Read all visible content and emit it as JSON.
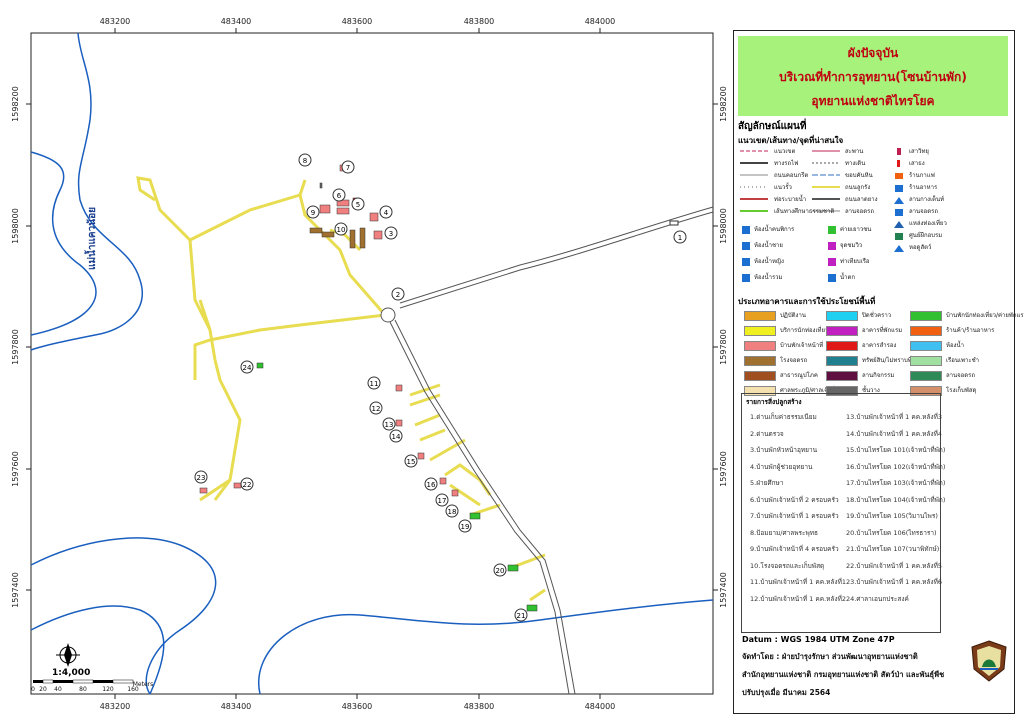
{
  "title": {
    "line1": "ผังปัจจุบัน",
    "line2": "บริเวณที่ทำการอุทยาน(โซนบ้านพัก)",
    "line3": "อุทยานแห่งชาติไทรโยค"
  },
  "legend": {
    "heading": "สัญลักษณ์แผนที่",
    "lines_heading": "แนวเขต/เส้นทาง/จุดที่น่าสนใจ",
    "lines": [
      {
        "label": "แนวเขต",
        "color": "#c02050"
      },
      {
        "label": "ทางรถไฟ",
        "color": "#444444"
      },
      {
        "label": "ถนนคอนกรีต",
        "color": "#888888"
      },
      {
        "label": "แนวรั้ว",
        "color": "#666666"
      },
      {
        "label": "ท่อระบายน้ำ",
        "color": "#c04040"
      },
      {
        "label": "เส้นทางศึกษาธรรมชาติ",
        "color": "#66cc33"
      },
      {
        "label": "สะพาน",
        "color": "#c02050"
      },
      {
        "label": "ทางเดิน",
        "color": "#555555"
      },
      {
        "label": "ขอบคันหิน",
        "color": "#3070c0"
      },
      {
        "label": "ถนนลูกรัง",
        "color": "#e8dc50"
      },
      {
        "label": "ถนนลาดยาง",
        "color": "#555555"
      },
      {
        "label": "ลานจอดรถ",
        "color": "#888888"
      }
    ],
    "points": [
      {
        "label": "เสาวิทยุ",
        "icon": "radio-tower-icon"
      },
      {
        "label": "เสาธง",
        "icon": "flag-icon"
      },
      {
        "label": "ร้านกาแฟ",
        "icon": "coffee-icon"
      },
      {
        "label": "ร้านอาหาร",
        "icon": "restaurant-icon"
      },
      {
        "label": "ลานกางเต็นท์",
        "icon": "tent-icon"
      },
      {
        "label": "ลานจอดรถ",
        "icon": "parking-icon"
      },
      {
        "label": "แหล่งท่องเที่ยว",
        "icon": "attraction-icon"
      },
      {
        "label": "ศูนย์ฝึกอบรม",
        "icon": "training-icon"
      },
      {
        "label": "หอดูสัตว์",
        "icon": "watchtower-icon"
      },
      {
        "label": "ห้องน้ำคนพิการ",
        "icon": "accessible-toilet-icon"
      },
      {
        "label": "ห้องน้ำชาย",
        "icon": "men-toilet-icon"
      },
      {
        "label": "ห้องน้ำหญิง",
        "icon": "women-toilet-icon"
      },
      {
        "label": "ห้องน้ำรวม",
        "icon": "restroom-icon"
      },
      {
        "label": "ค่ายเยาวชน",
        "icon": "youth-camp-icon"
      },
      {
        "label": "จุดชมวิว",
        "icon": "viewpoint-icon"
      },
      {
        "label": "ท่าเทียบเรือ",
        "icon": "pier-icon"
      },
      {
        "label": "น้ำตก",
        "icon": "waterfall-icon"
      }
    ],
    "building_heading": "ประเภทอาคารและการใช้ประโยชน์พื้นที่",
    "buildings": [
      {
        "label": "ปฏิบัติงาน",
        "color": "#e8a020"
      },
      {
        "label": "บริการนักท่องเที่ยว",
        "color": "#f0f020"
      },
      {
        "label": "บ้านพักเจ้าหน้าที่",
        "color": "#f08080"
      },
      {
        "label": "โรงจอดรถ",
        "color": "#a07030"
      },
      {
        "label": "สาธารณูปโภค",
        "color": "#a05020"
      },
      {
        "label": "ศาลพระภูมิ/ศาลเจ้าที่",
        "color": "#f5e0b0"
      },
      {
        "label": "ปิดชั่วคราว",
        "color": "#20d0f0"
      },
      {
        "label": "อาคารที่พักแรม",
        "color": "#c020c0"
      },
      {
        "label": "อาคารสำรอง",
        "color": "#e01818"
      },
      {
        "label": "ทรัพย์สิน/ไม่ทราบที่มา",
        "color": "#208090"
      },
      {
        "label": "ลานกิจกรรม",
        "color": "#601040"
      },
      {
        "label": "ชั้นวาง",
        "color": "#666666"
      },
      {
        "label": "บ้านพักนักท่องเที่ยว/ค่ายพักแรม",
        "color": "#30c030"
      },
      {
        "label": "ร้านค้า/ร้านอาหาร",
        "color": "#f06010"
      },
      {
        "label": "ห้องน้ำ",
        "color": "#40c0f0"
      },
      {
        "label": "เรือนเพาะชำ",
        "color": "#a0e0a0"
      },
      {
        "label": "ลานจอดรถ",
        "color": "#2e8b57"
      },
      {
        "label": "โรงเก็บพัสดุ",
        "color": "#d4906a"
      }
    ]
  },
  "buildings_list": {
    "heading": "รายการสิ่งปลูกสร้าง",
    "items": [
      "1.ด่านเก็บค่าธรรมเนียม",
      "2.ด่านตรวจ",
      "3.บ้านพักหัวหน้าอุทยาน",
      "4.บ้านพักผู้ช่วยอุทยาน",
      "5.ฝ่ายศึกษา",
      "6.บ้านพักเจ้าหน้าที่ 2 ครอบครัว",
      "7.บ้านพักเจ้าหน้าที่ 1 ครอบครัว",
      "8.ป้อมยาม/ศาลพระพุทธ",
      "9.บ้านพักเจ้าหน้าที่ 4 ครอบครัว",
      "10.โรงจอดรถและเก็บพัสดุ",
      "11.บ้านพักเจ้าหน้าที่ 1 คค.หลังที่1",
      "12.บ้านพักเจ้าหน้าที่ 1 คค.หลังที่2",
      "13.บ้านพักเจ้าหน้าที่ 1 คค.หลังที่3",
      "14.บ้านพักเจ้าหน้าที่ 1 คค.หลังที่4",
      "15.บ้านไทรโยค 101(เจ้าหน้าที่พัก)",
      "16.บ้านไทรโยค 102(เจ้าหน้าที่พัก)",
      "17.บ้านไทรโยค 103(เจ้าหน้าที่พัก)",
      "18.บ้านไทรโยค 104(เจ้าหน้าที่พัก)",
      "19.บ้านไทรโยค 105(วิมานไพร)",
      "20.บ้านไทรโยค 106(ไทรธารา)",
      "21.บ้านไทรโยค 107(วนาพิทักษ์)",
      "22.บ้านพักเจ้าหน้าที่ 1 คค.หลังที่5",
      "23.บ้านพักเจ้าหน้าที่ 1 คค.หลังที่6",
      "24.ศาลาเอนกประสงค์"
    ]
  },
  "datum": "Datum  : WGS 1984 UTM Zone 47P",
  "credits": {
    "line1": "จัดทำโดย  :  ฝ่ายบำรุงรักษา ส่วนพัฒนาอุทยานแห่งชาติ",
    "line2": "สำนักอุทยานแห่งชาติ  กรมอุทยานแห่งชาติ สัตว์ป่า และพันธุ์พืช",
    "line3": "ปรับปรุงเมื่อ มีนาคม 2564"
  },
  "map": {
    "river_label": "แม่น้ำแควน้อย",
    "scale_ratio": "1:4,000",
    "scale_ticks": [
      "0",
      "20",
      "40",
      "80",
      "120",
      "160"
    ],
    "scale_unit": "Meters",
    "x_coords": [
      "483200",
      "483400",
      "483600",
      "483800",
      "484000"
    ],
    "y_coords": [
      "1598200",
      "1598000",
      "1597800",
      "1597600",
      "1597400"
    ],
    "markers": [
      "1",
      "2",
      "3",
      "4",
      "5",
      "6",
      "7",
      "8",
      "9",
      "10",
      "11",
      "12",
      "13",
      "14",
      "15",
      "16",
      "17",
      "18",
      "19",
      "20",
      "21",
      "22",
      "23",
      "24"
    ]
  }
}
